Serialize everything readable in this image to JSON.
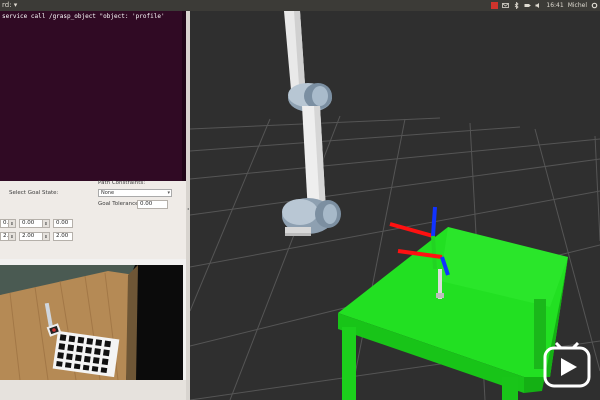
{
  "window": {
    "title_fragment": "rd: ▾"
  },
  "tray": {
    "time": "16:41",
    "user": "Michel"
  },
  "terminal": {
    "line1": "service call /grasp_object \"object: 'profile'"
  },
  "planning": {
    "select_goal_state_label": "Select Goal State:",
    "path_constraints_label": "Path Constraints:",
    "path_constraints_value": "None",
    "goal_tolerance_label": "Goal Tolerance:",
    "goal_tolerance_value": "0.00",
    "row1": [
      "0.00",
      "0.00",
      "0.00"
    ],
    "row2": [
      "2.00",
      "2.00",
      "2.00"
    ]
  },
  "colors": {
    "terminal_bg": "#300a24",
    "table": "#22e022",
    "viewport_bg": "#303030",
    "axis_red": "#ff1111",
    "axis_green": "#22d422",
    "axis_blue": "#1133ff"
  },
  "icons": [
    "network-icon",
    "mail-icon",
    "bluetooth-icon",
    "battery-icon",
    "volume-icon",
    "gear-icon",
    "play-icon"
  ]
}
